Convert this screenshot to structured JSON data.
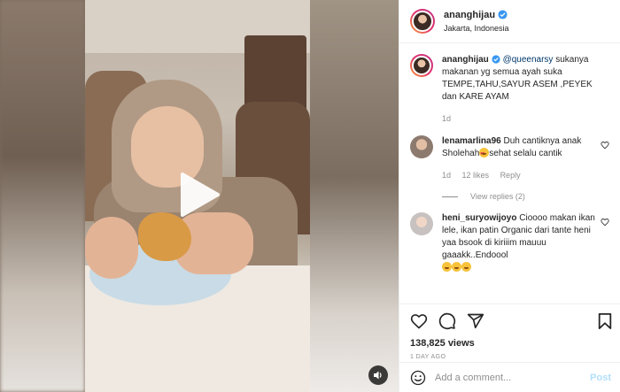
{
  "header": {
    "username": "ananghijau",
    "location": "Jakarta, Indonesia"
  },
  "caption": {
    "username": "ananghijau",
    "mention": "@queenarsy",
    "text": " sukanya makanan yg semua ayah suka TEMPE,TAHU,SAYUR ASEM ,PEYEK dan KARE AYAM",
    "time": "1d"
  },
  "comments": [
    {
      "username": "lenamarlina96",
      "text_before": "Duh cantiknya anak Sholehah",
      "emoji": "heart-eyes",
      "text_after": "sehat selalu cantik",
      "time": "1d",
      "likes": "12 likes",
      "reply": "Reply",
      "view_replies": "View replies (2)"
    },
    {
      "username": "heni_suryowijoyo",
      "text": "Cioooo makan ikan lele, ikan patin Organic dari tante heni yaa bsook di kiriiim mauuu gaaakk..Endoool",
      "emoji": "laughing"
    }
  ],
  "stats": {
    "views": "138,825 views",
    "posted": "1 DAY AGO"
  },
  "composer": {
    "placeholder": "Add a comment...",
    "post_label": "Post"
  },
  "colors": {
    "verified": "#3897f0",
    "link": "#00376b",
    "post_button": "#b2dffc",
    "muted": "#8e8e8e"
  },
  "icons": [
    "play-icon",
    "sound-icon",
    "verified-icon",
    "heart-icon",
    "comment-icon",
    "share-icon",
    "bookmark-icon",
    "emoji-icon"
  ]
}
